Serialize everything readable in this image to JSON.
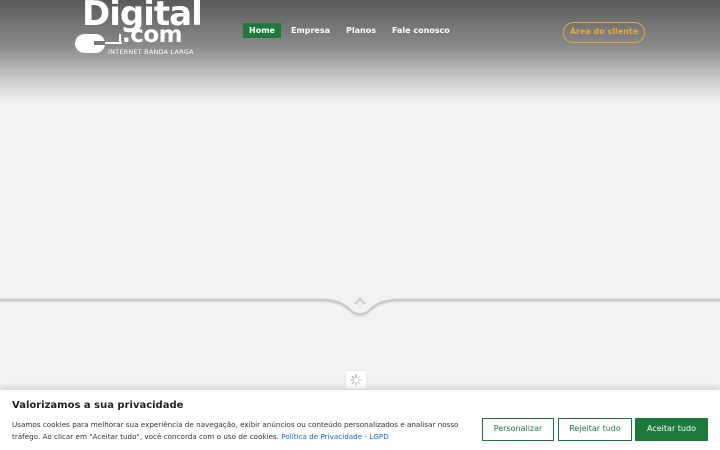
{
  "header": {
    "logo": {
      "word": "Digital",
      "dotcom": ".com",
      "tagline": "INTERNET BANDA LARGA"
    },
    "nav": [
      {
        "label": "Home",
        "active": true
      },
      {
        "label": "Empresa",
        "active": false
      },
      {
        "label": "Planos",
        "active": false
      },
      {
        "label": "Fale conosco",
        "active": false
      }
    ],
    "client_area_label": "Área do cliente"
  },
  "cookie_banner": {
    "title": "Valorizamos a sua privacidade",
    "text": "Usamos cookies para melhorar sua experiência de navegação, exibir anúncios ou conteúdo personalizados e analisar nosso tráfego. Ao clicar em \"Aceitar tudo\", você concorda com o uso de cookies. ",
    "policy_link": "Política de Privacidade - LGPD",
    "buttons": {
      "customize": "Personalizar",
      "reject": "Rejeitar tudo",
      "accept": "Aceitar tudo"
    }
  },
  "colors": {
    "brand_green": "#1e7a3c",
    "accent_orange": "#e8a93a",
    "link_blue": "#1863dc"
  },
  "icons": {
    "scroll_up": "chevron-up-icon",
    "loading": "spinner-icon",
    "logo_mouse": "mouse-icon"
  }
}
